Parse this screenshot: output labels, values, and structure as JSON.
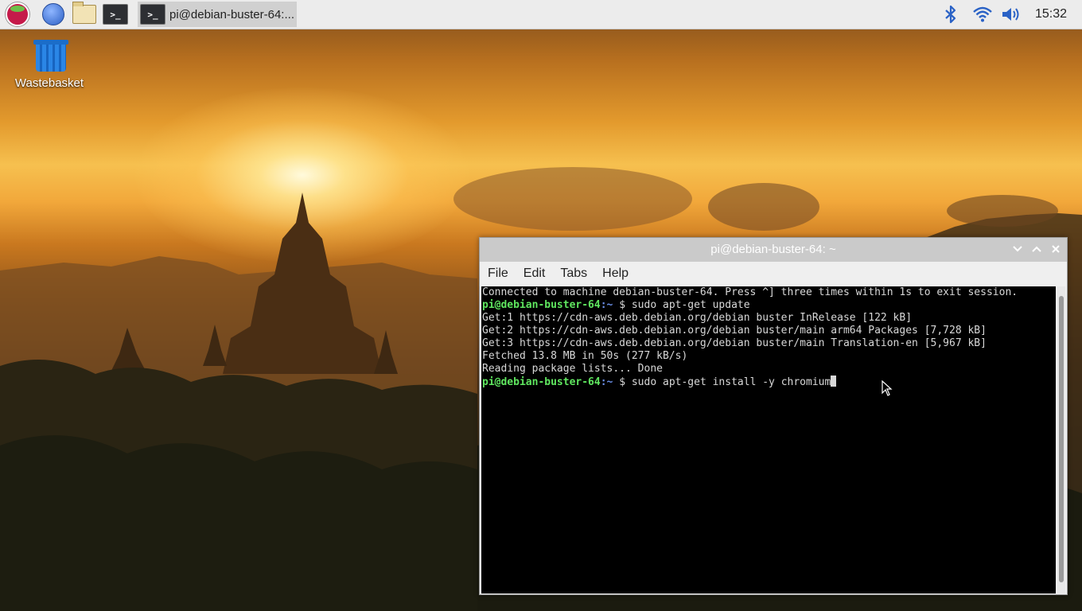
{
  "taskbar": {
    "launchers": [
      {
        "name": "raspberry-menu-icon"
      },
      {
        "name": "web-browser-icon"
      },
      {
        "name": "file-manager-icon"
      },
      {
        "name": "terminal-icon"
      }
    ],
    "task_label": "pi@debian-buster-64:...",
    "clock": "15:32"
  },
  "desktop": {
    "icons": [
      {
        "label": "Wastebasket",
        "icon": "wastebasket-icon"
      }
    ]
  },
  "terminal": {
    "title": "pi@debian-buster-64: ~",
    "menu": [
      "File",
      "Edit",
      "Tabs",
      "Help"
    ],
    "lines": [
      {
        "text": "Connected to machine debian-buster-64. Press ^] three times within 1s to exit session."
      },
      {
        "prompt_user": "pi@debian-buster-64",
        "prompt_path": ":~",
        "prompt_symbol": " $ ",
        "command": "sudo apt-get update"
      },
      {
        "text": "Get:1 https://cdn-aws.deb.debian.org/debian buster InRelease [122 kB]"
      },
      {
        "text": "Get:2 https://cdn-aws.deb.debian.org/debian buster/main arm64 Packages [7,728 kB]"
      },
      {
        "text": "Get:3 https://cdn-aws.deb.debian.org/debian buster/main Translation-en [5,967 kB]"
      },
      {
        "text": "Fetched 13.8 MB in 50s (277 kB/s)"
      },
      {
        "text": "Reading package lists... Done"
      },
      {
        "prompt_user": "pi@debian-buster-64",
        "prompt_path": ":~",
        "prompt_symbol": " $ ",
        "command": "sudo apt-get install -y chromium"
      }
    ]
  },
  "colors": {
    "prompt_user": "#5fe65f",
    "prompt_path": "#6b8fe8",
    "console_text": "#d8d8d8",
    "console_bg": "#000000"
  }
}
